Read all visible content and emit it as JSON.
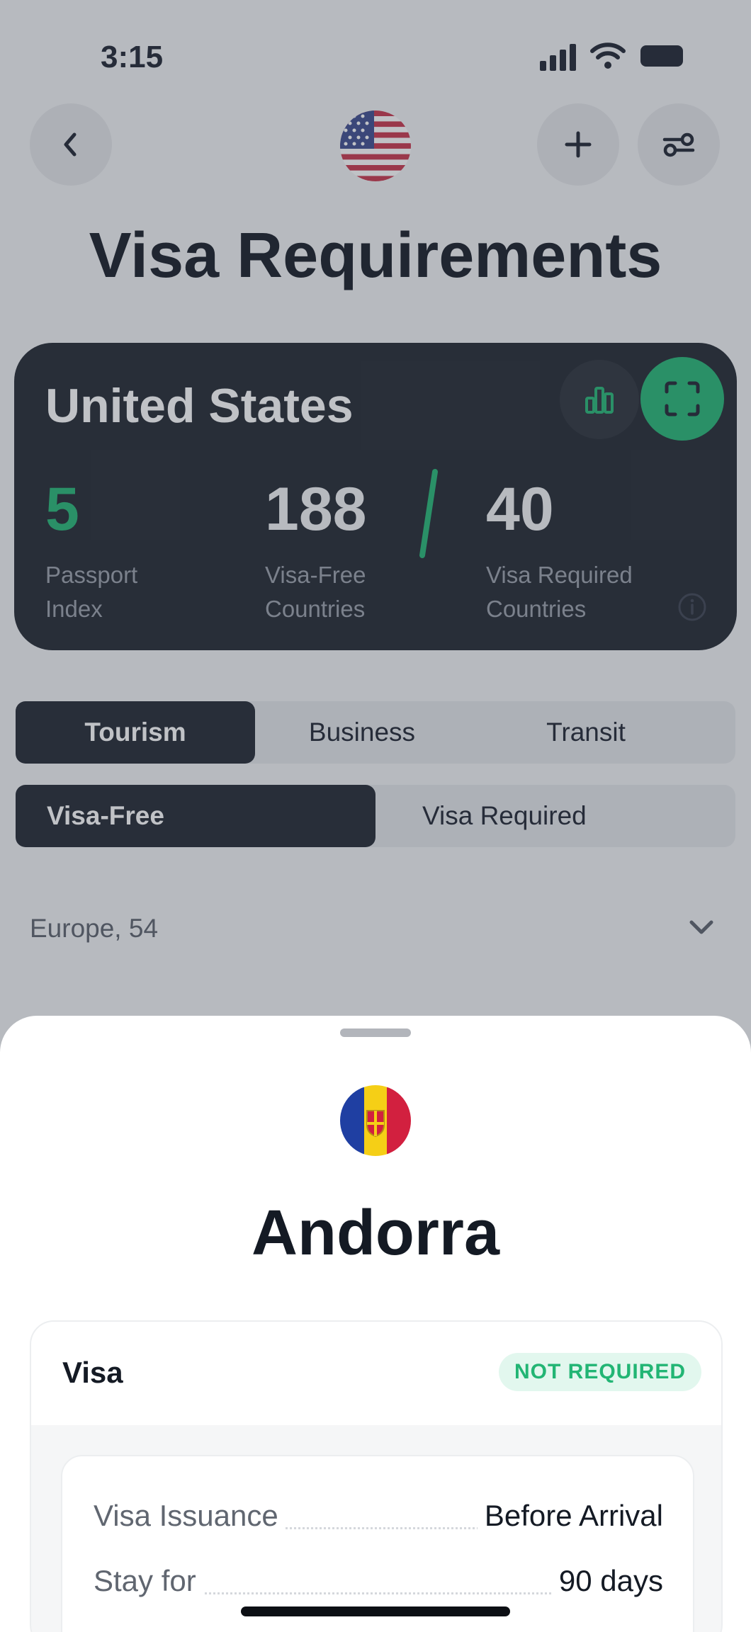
{
  "status_bar": {
    "time": "3:15"
  },
  "header": {
    "title": "Visa Requirements",
    "back_icon": "back-icon",
    "add_icon": "plus-icon",
    "filter_icon": "sliders-icon"
  },
  "summary": {
    "country": "United States",
    "passport_index": {
      "value": "5",
      "label_line1": "Passport",
      "label_line2": "Index"
    },
    "visa_free": {
      "value": "188",
      "label_line1": "Visa-Free",
      "label_line2": "Countries"
    },
    "visa_required": {
      "value": "40",
      "label_line1": "Visa Required",
      "label_line2": "Countries"
    },
    "accent": "#22b574"
  },
  "purpose_tabs": [
    {
      "label": "Tourism",
      "selected": true
    },
    {
      "label": "Business",
      "selected": false
    },
    {
      "label": "Transit",
      "selected": false
    }
  ],
  "visa_tabs": [
    {
      "label": "Visa-Free",
      "selected": true
    },
    {
      "label": "Visa Required",
      "selected": false
    }
  ],
  "region_row": {
    "label": "Europe, 54"
  },
  "sheet": {
    "country": "Andorra",
    "section_label": "Visa",
    "status_badge": "NOT REQUIRED",
    "details": [
      {
        "key": "Visa Issuance",
        "value": "Before Arrival"
      },
      {
        "key": "Stay for",
        "value": "90 days"
      }
    ]
  }
}
